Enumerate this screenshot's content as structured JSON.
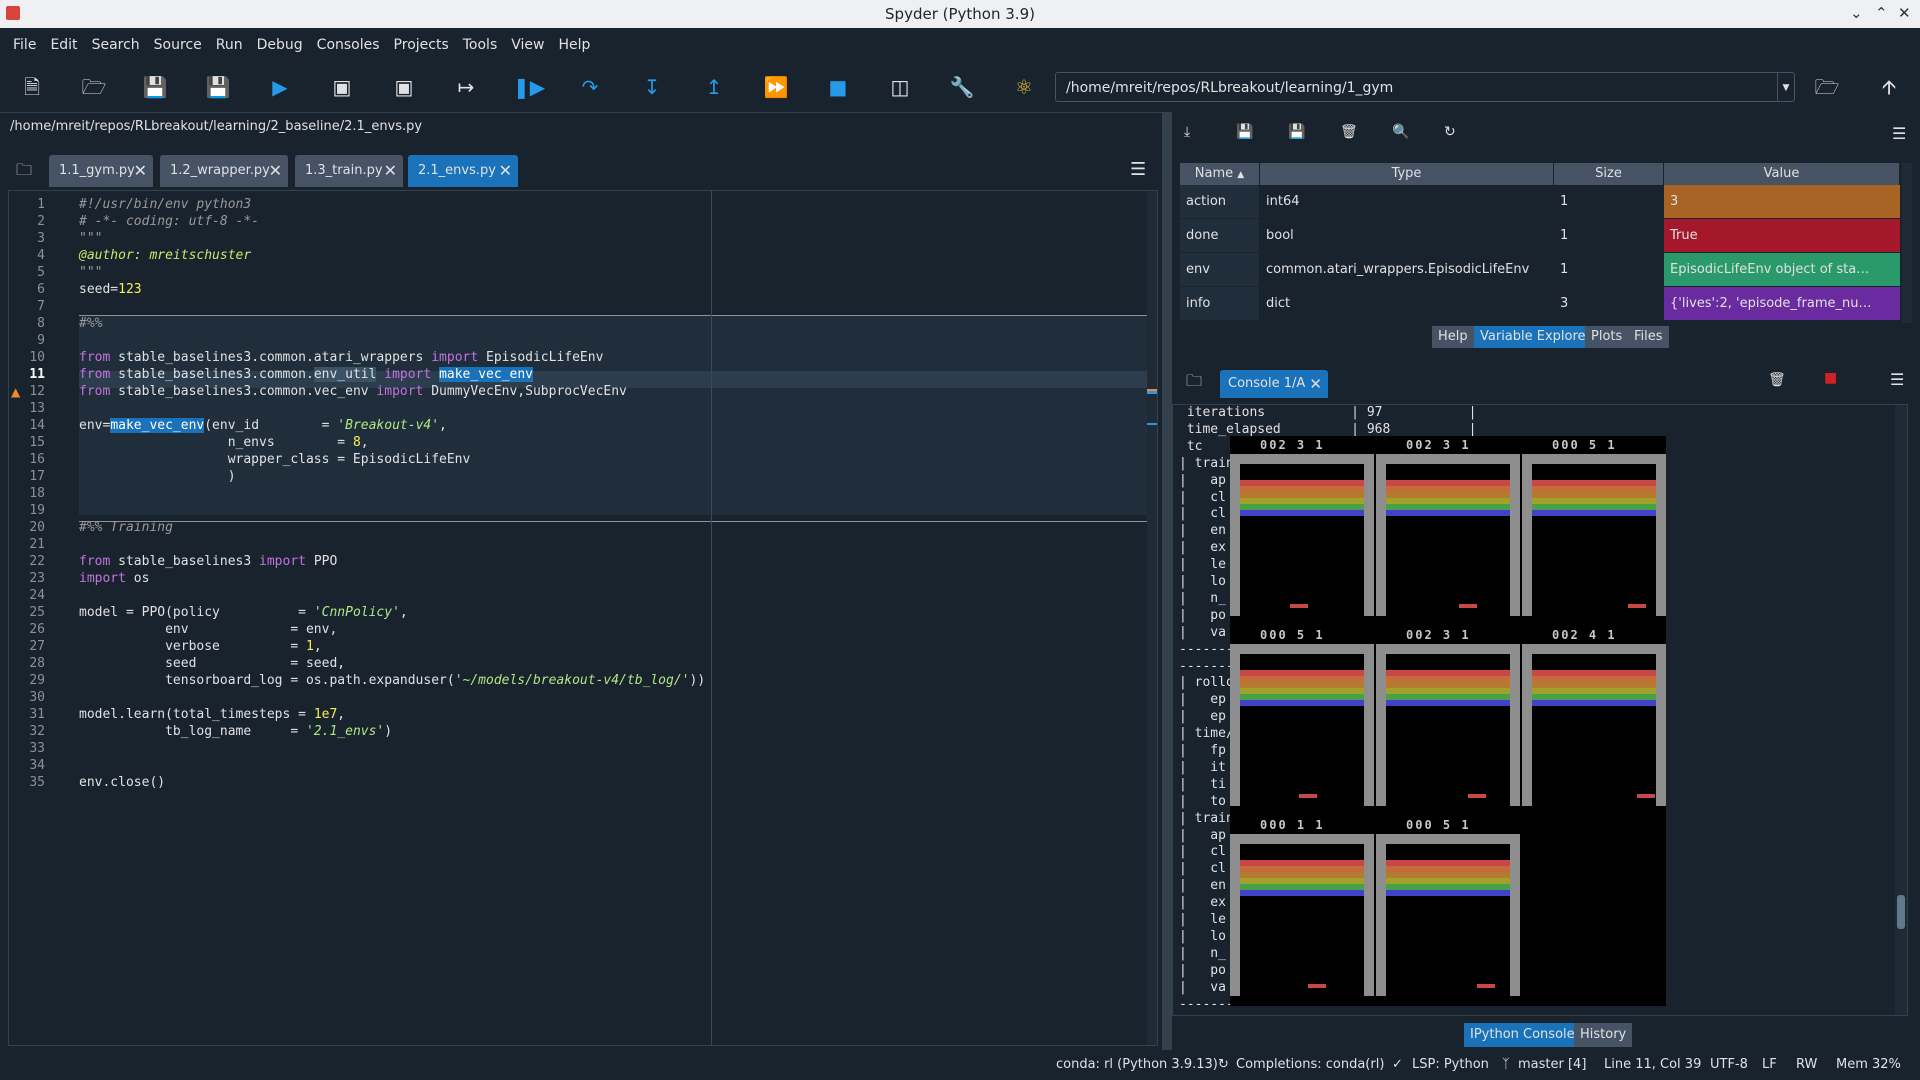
{
  "window": {
    "title": "Spyder (Python 3.9)"
  },
  "menu": [
    "File",
    "Edit",
    "Search",
    "Source",
    "Run",
    "Debug",
    "Consoles",
    "Projects",
    "Tools",
    "View",
    "Help"
  ],
  "toolbar": {
    "path": "/home/mreit/repos/RLbreakout/learning/1_gym"
  },
  "editor": {
    "filepath": "/home/mreit/repos/RLbreakout/learning/2_baseline/2.1_envs.py",
    "tabs": [
      {
        "label": "1.1_gym.py"
      },
      {
        "label": "1.2_wrapper.py"
      },
      {
        "label": "1.3_train.py"
      },
      {
        "label": "2.1_envs.py"
      }
    ],
    "line_numbers": [
      "1",
      "2",
      "3",
      "4",
      "5",
      "6",
      "7",
      "8",
      "9",
      "10",
      "11",
      "12",
      "13",
      "14",
      "15",
      "16",
      "17",
      "18",
      "19",
      "20",
      "21",
      "22",
      "23",
      "24",
      "25",
      "26",
      "27",
      "28",
      "29",
      "30",
      "31",
      "32",
      "33",
      "34",
      "35"
    ],
    "code": {
      "l1": "#!/usr/bin/env python3",
      "l2": "# -*- coding: utf-8 -*-",
      "l3": "\"\"\"",
      "l4": "@author: mreitschuster",
      "l5": "\"\"\"",
      "l6a": "seed=",
      "l6b": "123",
      "l8": "#%%",
      "l10a": "from",
      "l10b": " stable_baselines3.common.atari_wrappers ",
      "l10c": "import",
      "l10d": " EpisodicLifeEnv",
      "l11a": "from",
      "l11b": " stable_baselines3.common.",
      "l11c": "env_util",
      "l11d": " ",
      "l11e": "import",
      "l11f": " ",
      "l11g": "make_vec_env",
      "l12a": "from",
      "l12b": " stable_baselines3.common.vec_env ",
      "l12c": "import",
      "l12d": " DummyVecEnv,SubprocVecEnv",
      "l14a": "env=",
      "l14b": "make_vec_env",
      "l14c": "(env_id        = ",
      "l14d": "'Breakout-v4'",
      "l14e": ",",
      "l15a": "                   n_envs        = ",
      "l15b": "8",
      "l15c": ",",
      "l16": "                   wrapper_class = EpisodicLifeEnv",
      "l17": "                   )",
      "l20": "#%% Training",
      "l22a": "from",
      "l22b": " stable_baselines3 ",
      "l22c": "import",
      "l22d": " PPO",
      "l23a": "import",
      "l23b": " os",
      "l25a": "model = PPO(policy          = ",
      "l25b": "'CnnPolicy'",
      "l25c": ",",
      "l26": "           env             = env,",
      "l27a": "           verbose         = ",
      "l27b": "1",
      "l27c": ",",
      "l28": "           seed            = seed,",
      "l29a": "           tensorboard_log = os.path.expanduser(",
      "l29b": "'~/models/breakout-v4/tb_log/'",
      "l29c": "))",
      "l31a": "model.learn(total_timesteps = ",
      "l31b": "1e7",
      "l31c": ",",
      "l32a": "           tb_log_name     = ",
      "l32b": "'2.1_envs'",
      "l32c": ")",
      "l35": "env.close()"
    }
  },
  "variable_explorer": {
    "headers": [
      "Name",
      "Type",
      "Size",
      "Value"
    ],
    "rows": [
      {
        "name": "action",
        "type": "int64",
        "size": "1",
        "value": "3",
        "color": "#a86425"
      },
      {
        "name": "done",
        "type": "bool",
        "size": "1",
        "value": "True",
        "color": "#a5182b"
      },
      {
        "name": "env",
        "type": "common.atari_wrappers.EpisodicLifeEnv",
        "size": "1",
        "value": "EpisodicLifeEnv object of sta…",
        "color": "#2a9a6a"
      },
      {
        "name": "info",
        "type": "dict",
        "size": "3",
        "value": "{'lives':2, 'episode_frame_nu…",
        "color": "#6a2aa0"
      }
    ],
    "pane_tabs": [
      "Help",
      "Variable Explorer",
      "Plots",
      "Files"
    ]
  },
  "console": {
    "tab": "Console 1/A",
    "bottom_tabs": [
      "IPython Console",
      "History"
    ],
    "lines": [
      " iterations           | 97           |",
      " time_elapsed         | 968          |",
      " tc",
      "| train",
      "|   ap",
      "|   cl",
      "|   cl",
      "|   en",
      "|   ex",
      "|   le",
      "|   lo",
      "|   n_",
      "|   po",
      "|   va",
      "--------",
      "--------",
      "| rollo",
      "|   ep",
      "|   ep",
      "| time/",
      "|   fp",
      "|   it",
      "|   ti",
      "|   to",
      "| train",
      "|   ap",
      "|   cl",
      "|   cl",
      "|   en",
      "|   ex",
      "|   le",
      "|   lo",
      "|   n_",
      "|   po",
      "|   va",
      "-------------------------------------------------"
    ],
    "scores": [
      "002 3 1",
      "002 3 1",
      "000 5 1",
      "000 5 1",
      "002 3 1",
      "002 4 1",
      "000 1 1",
      "000 5 1"
    ],
    "brick_colors": [
      "#c84848",
      "#c66c3a",
      "#b47a30",
      "#a2a22a",
      "#48a048",
      "#4242c8"
    ]
  },
  "status": {
    "env": "conda: rl (Python 3.9.13)",
    "completions": "Completions: conda(rl)",
    "lsp": "LSP: Python",
    "git": "master [4]",
    "position": "Line 11, Col 39",
    "encoding": "UTF-8",
    "eol": "LF",
    "mode": "RW",
    "mem": "Mem 32%"
  }
}
